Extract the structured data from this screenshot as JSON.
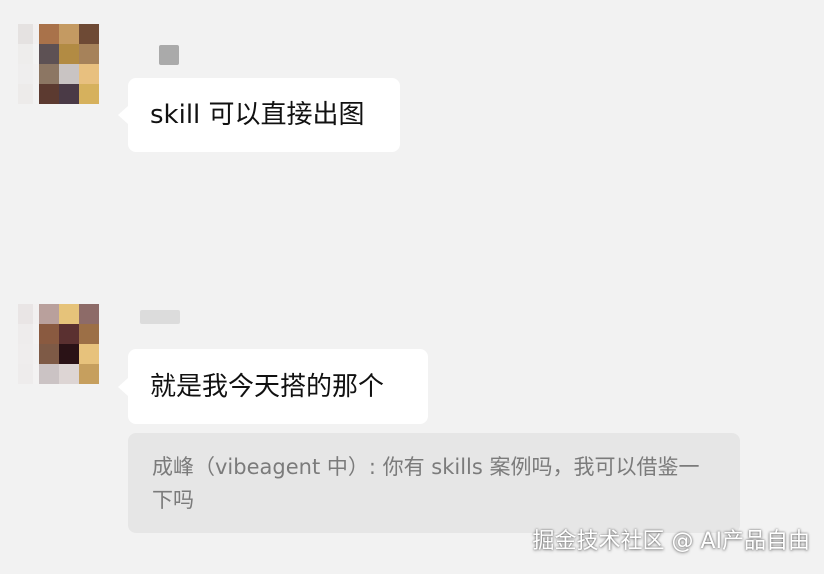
{
  "chat": {
    "messages": [
      {
        "text": "skill 可以直接出图",
        "avatar_colors": [
          "#a9724a",
          "#c49a62",
          "#6e4a35",
          "#5d5154",
          "#b28b43",
          "#a6825a",
          "#8c7663",
          "#c9c4c3",
          "#e8c07f",
          "#5c3a30",
          "#4a3a46",
          "#d6b15d"
        ],
        "ghost_colors": [
          "#cfc6c4",
          "#f2efee",
          "#e9e4e3",
          "#f7f5f5",
          "#ece7e7",
          "#f3f1f0",
          "#e4dfde",
          "#f4f3f2"
        ],
        "name_blur_color": "#aaaaaa"
      },
      {
        "text": "就是我今天搭的那个",
        "avatar_colors": [
          "#b9a09c",
          "#e6c37a",
          "#8d6b68",
          "#8a5a40",
          "#5a3030",
          "#9c6f46",
          "#7e5a46",
          "#2a1216",
          "#e7c27c",
          "#cbc3c4",
          "#ddd5d4",
          "#c69f5e"
        ],
        "ghost_colors": [
          "#d9cfce",
          "#f3efef",
          "#e8e2e1",
          "#f5f3f2",
          "#ebe6e5",
          "#f4f1f0",
          "#e7e3e3",
          "#f5f4f3"
        ],
        "name_blur_color": "#dcdcdc"
      }
    ],
    "quote": {
      "text": "成峰（vibeagent 中）: 你有 skills 案例吗，我可以借鉴一下吗"
    }
  },
  "watermark": {
    "text": "掘金技术社区 @ AI产品自由"
  }
}
